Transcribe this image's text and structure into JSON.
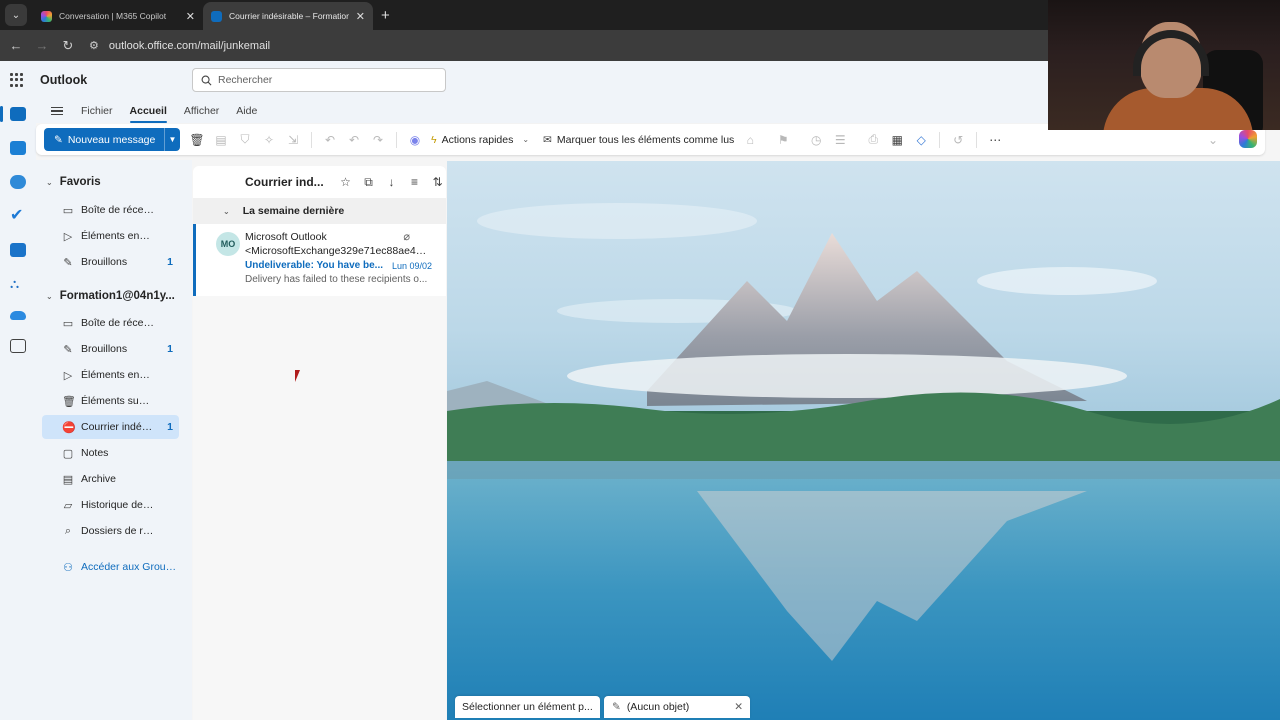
{
  "browser": {
    "tabs": [
      {
        "title": "Conversation | M365 Copilot",
        "active": false
      },
      {
        "title": "Courrier indésirable – Formation1",
        "active": true
      }
    ],
    "url": "outlook.office.com/mail/junkemail"
  },
  "app": {
    "title": "Outlook",
    "search_placeholder": "Rechercher"
  },
  "menu": {
    "items": [
      "Fichier",
      "Accueil",
      "Afficher",
      "Aide"
    ],
    "active": "Accueil"
  },
  "ribbon": {
    "new_message": "Nouveau message",
    "quick_actions": "Actions rapides",
    "mark_all_read": "Marquer tous les éléments comme lus"
  },
  "folders": {
    "favorites_label": "Favoris",
    "favorites": [
      {
        "label": "Boîte de réception",
        "count": "",
        "icon": "inbox-icon"
      },
      {
        "label": "Éléments envoyés",
        "count": "",
        "icon": "send-icon"
      },
      {
        "label": "Brouillons",
        "count": "1",
        "icon": "draft-icon"
      }
    ],
    "account_label": "Formation1@04n1y...",
    "account": [
      {
        "label": "Boîte de réception",
        "count": "",
        "icon": "inbox-icon"
      },
      {
        "label": "Brouillons",
        "count": "1",
        "icon": "draft-icon"
      },
      {
        "label": "Éléments envoyés",
        "count": "",
        "icon": "send-icon"
      },
      {
        "label": "Éléments supprimés",
        "count": "",
        "icon": "trash-icon"
      },
      {
        "label": "Courrier indésir...",
        "count": "1",
        "icon": "junk-icon"
      },
      {
        "label": "Notes",
        "count": "",
        "icon": "note-icon"
      },
      {
        "label": "Archive",
        "count": "",
        "icon": "archive-icon"
      },
      {
        "label": "Historique des con...",
        "count": "",
        "icon": "folder-icon"
      },
      {
        "label": "Dossiers de recher...",
        "count": "",
        "icon": "search-folder-icon"
      }
    ],
    "groups_link": "Accéder aux Group..."
  },
  "message_list": {
    "title": "Courrier ind...",
    "group_header": "La semaine dernière",
    "messages": [
      {
        "initials": "MO",
        "from": "Microsoft Outlook",
        "address": "<MicrosoftExchange329e71ec88ae461...",
        "subject": "Undeliverable: You have be...",
        "date": "Lun 09/02",
        "preview": "Delivery has failed to these recipients o..."
      }
    ]
  },
  "bottom_tabs": {
    "select_item": "Sélectionner un élément p...",
    "draft_subject": "(Aucun objet)"
  },
  "colors": {
    "accent": "#0f6cbd",
    "selected_folder": "#cfe4fa",
    "pane_bg": "#f0f4f9"
  }
}
